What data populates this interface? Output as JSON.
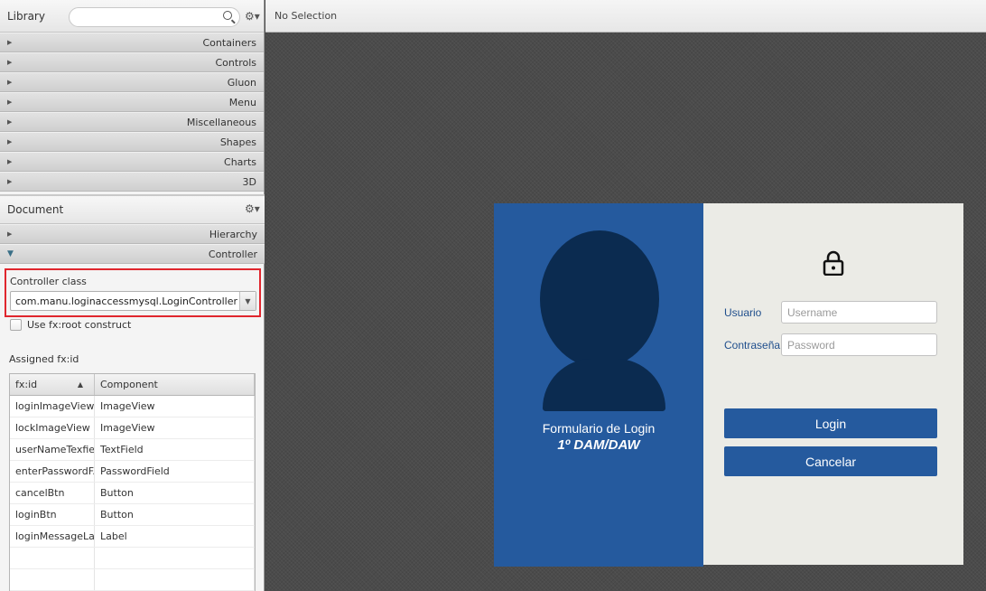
{
  "library": {
    "title": "Library",
    "search_placeholder": "",
    "sections": [
      "Containers",
      "Controls",
      "Gluon",
      "Menu",
      "Miscellaneous",
      "Shapes",
      "Charts",
      "3D"
    ]
  },
  "document": {
    "title": "Document",
    "sections": [
      "Hierarchy",
      "Controller"
    ],
    "controller_class_label": "Controller class",
    "controller_class_value": "com.manu.loginaccessmysql.LoginController",
    "root_construct_label": "Use fx:root construct",
    "assigned_label": "Assigned fx:id",
    "table": {
      "headers": [
        "fx:id",
        "Component"
      ],
      "rows": [
        [
          "loginImageView",
          "ImageView"
        ],
        [
          "lockImageView",
          "ImageView"
        ],
        [
          "userNameTexfield",
          "TextField"
        ],
        [
          "enterPasswordF...",
          "PasswordField"
        ],
        [
          "cancelBtn",
          "Button"
        ],
        [
          "loginBtn",
          "Button"
        ],
        [
          "loginMessageLa...",
          "Label"
        ]
      ]
    }
  },
  "editor": {
    "selection": "No Selection"
  },
  "form": {
    "title": "Formulario de Login",
    "subtitle": "1º DAM/DAW",
    "user_label": "Usuario",
    "user_placeholder": "Username",
    "password_label": "Contraseña",
    "password_placeholder": "Password",
    "login_button": "Login",
    "cancel_button": "Cancelar"
  },
  "colors": {
    "form_blue": "#255a9e",
    "avatar": "#0b2b50",
    "form_grey": "#ebebe6",
    "highlight": "#e0262e"
  }
}
